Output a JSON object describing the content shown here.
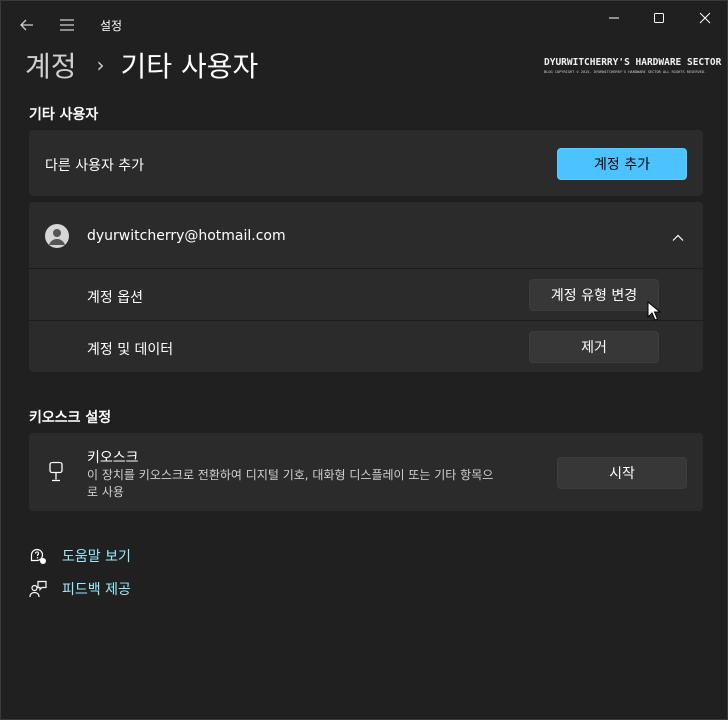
{
  "window": {
    "title": "설정",
    "back_icon": "back-arrow-icon",
    "menu_icon": "hamburger-icon"
  },
  "breadcrumb": {
    "parent": "계정",
    "separator": "›",
    "current": "기타 사용자"
  },
  "watermark": {
    "line1": "DYURWITCHERRY'S HARDWARE SECTOR",
    "line2": "BLOG COPYRIGHT © 2015. DYURWITCHERRY'S HARDWARE SECTOR ALL RIGHTS RESERVED."
  },
  "other_users": {
    "section_title": "기타 사용자",
    "add_user_label": "다른 사용자 추가",
    "add_account_button": "계정 추가",
    "user": {
      "email": "dyurwitcherry@hotmail.com",
      "account_options_label": "계정 옵션",
      "change_type_button": "계정 유형 변경",
      "account_data_label": "계정 및 데이터",
      "remove_button": "제거"
    }
  },
  "kiosk": {
    "section_title": "키오스크 설정",
    "title": "키오스크",
    "description_line1": "이 장치를 키오스크로 전환하여 디지털 기호, 대화형 디스플레이 또는 기타 항목으",
    "description_line2": "로 사용",
    "start_button": "시작"
  },
  "links": {
    "help": "도움말 보기",
    "feedback": "피드백 제공"
  },
  "colors": {
    "background": "#202020",
    "card": "#2b2b2b",
    "accent": "#4cc2ff",
    "link": "#99ebff"
  }
}
